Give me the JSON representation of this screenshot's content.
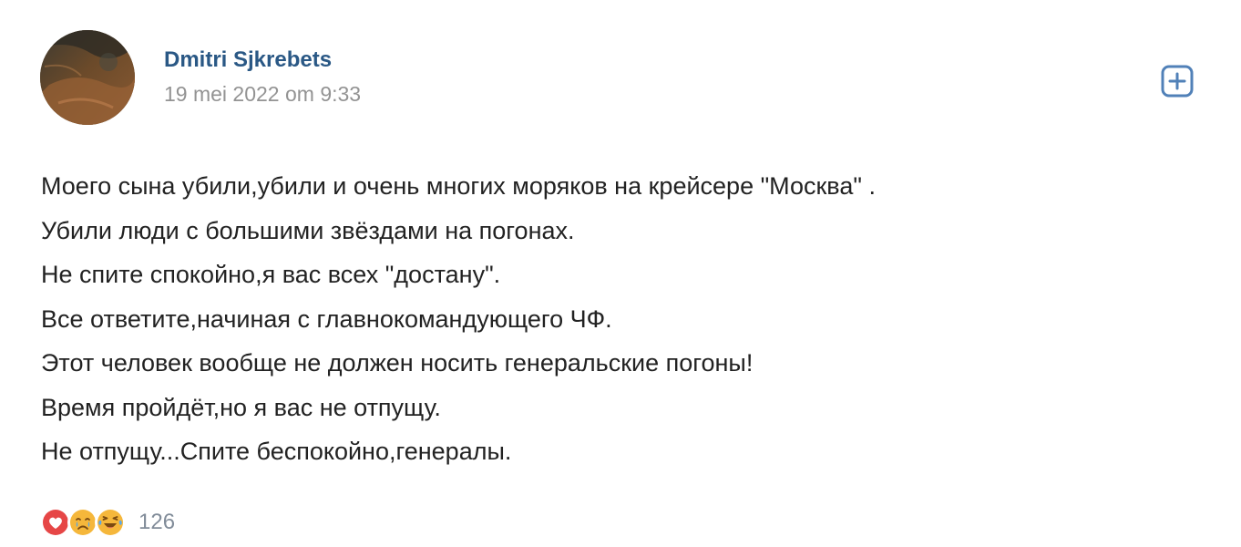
{
  "post": {
    "author_name": "Dmitri Sjkrebets",
    "date": "19 mei 2022 om 9:33",
    "lines": [
      "Моего сына убили,убили и очень многих моряков на крейсере \"Москва\" .",
      "Убили люди с большими звёздами на погонах.",
      "Не спите спокойно,я вас всех \"достану\".",
      "Все ответите,начиная с главнокомандующего ЧФ.",
      "Этот человек вообще не должен носить генеральские погоны!",
      "Время пройдёт,но я вас не отпущу.",
      "Не отпущу...Спите беспокойно,генералы."
    ]
  },
  "reactions": {
    "icons": [
      "heart-reaction-icon",
      "crying-face-reaction-icon",
      "laughing-crying-face-reaction-icon"
    ],
    "count": "126"
  },
  "colors": {
    "accent": "#2a5885",
    "heart": "#e64646",
    "emoji": "#f5b73b"
  }
}
